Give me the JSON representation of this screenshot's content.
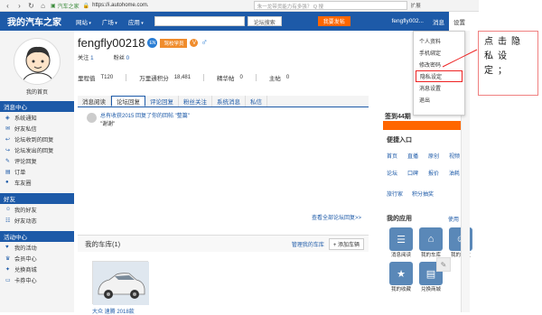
{
  "browser": {
    "bookmark": "汽车之家",
    "url": "https://i.autohome.com.",
    "search_placeholder": "朱一龙带货能力有多强？ Q 搜",
    "ext_label": "扩展"
  },
  "topbar": {
    "logo": "我的汽车之家",
    "nav": [
      "网站",
      "广场",
      "应用"
    ],
    "search_btn": "论坛搜索",
    "post_btn": "我要发帖",
    "user": "fengfly002...",
    "messages": "消息",
    "settings": "设置"
  },
  "dropdown": {
    "items": [
      "个人资料",
      "手机绑定",
      "修改密码",
      "隐私设定",
      "消息设置",
      "退出"
    ]
  },
  "annotation": "点击隐私设定；",
  "sidebar": {
    "my_page": "我的首页",
    "sections": [
      {
        "title": "消息中心",
        "items": [
          "系统通知",
          "好友私信",
          "论坛收到的回复",
          "论坛发出的回复",
          "评论回复",
          "订单",
          "车友圈"
        ]
      },
      {
        "title": "好友",
        "items": [
          "我的好友",
          "好友动态"
        ]
      },
      {
        "title": "活动中心",
        "items": [
          "我的活动",
          "会员中心",
          "兑换商城",
          "卡券中心"
        ]
      }
    ]
  },
  "profile": {
    "username": "fengfly00218",
    "badge_en": "EN",
    "badge_level": "驾校学员",
    "badge_v": "V",
    "gender": "♂",
    "follow_label": "关注",
    "follow_count": "1",
    "fans_label": "粉丝",
    "fans_count": "0",
    "stats": [
      {
        "label": "里程值",
        "value": "T120"
      },
      {
        "label": "万里通积分",
        "value": "18,481"
      },
      {
        "label": "精华帖",
        "value": "0"
      },
      {
        "label": "主帖",
        "value": "0"
      }
    ]
  },
  "tabs": [
    "消息阅读",
    "论坛回复",
    "评论回复",
    "粉丝关注",
    "系统消息",
    "私信"
  ],
  "message": {
    "line1": "总有收获2015 回复了你的回帖 \"整篇\"",
    "line2": "\"谢谢\""
  },
  "view_all": "查看全部论坛回复>>",
  "garage": {
    "title": "我的车库(1)",
    "manage": "管理我的车库",
    "add": "+ 添加车辆",
    "car_name": "大众 速腾 2018款"
  },
  "right": {
    "sign_title": "签到44期",
    "quick_title": "便捷入口",
    "quick_links": [
      "首页",
      "直播",
      "原创",
      "视频",
      "论坛",
      "口碑",
      "报价",
      "油耗"
    ],
    "quick_links2": [
      "旅行家",
      "积分抽奖"
    ],
    "apps_title": "我的应用",
    "use_all": "使用",
    "apps": [
      {
        "icon": "☰",
        "label": "消息阅读"
      },
      {
        "icon": "⌂",
        "label": "我的车库"
      },
      {
        "icon": "☺",
        "label": "我的好友"
      },
      {
        "icon": "★",
        "label": "我的收藏"
      },
      {
        "icon": "▤",
        "label": "兑换商城"
      }
    ]
  }
}
